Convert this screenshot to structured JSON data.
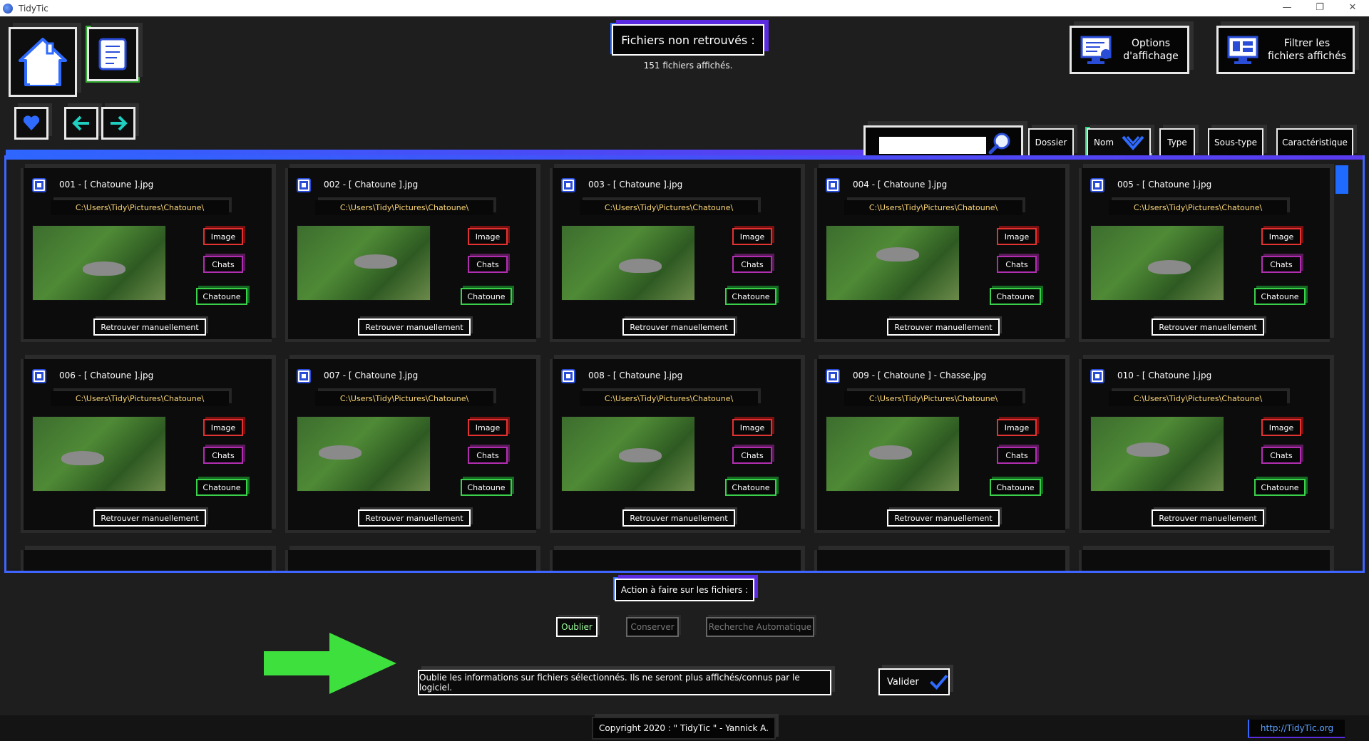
{
  "window": {
    "title": "TidyTic",
    "controls": [
      "—",
      "❐",
      "✕"
    ]
  },
  "header": {
    "title": "Fichiers non retrouvés :",
    "subtitle": "151 fichiers affichés."
  },
  "top_buttons": {
    "options_label_1": "Options",
    "options_label_2": "d'affichage",
    "filter_label_1": "Filtrer les",
    "filter_label_2": "fichiers affichés"
  },
  "sort": {
    "search_value": "",
    "buttons": [
      "Dossier",
      "Nom",
      "Type",
      "Sous-type",
      "Caractéristique"
    ],
    "active": "Nom"
  },
  "files": [
    {
      "name": "001 - [ Chatoune ].jpg",
      "path": "C:\\Users\\Tidy\\Pictures\\Chatoune\\",
      "tag1": "Image",
      "tag2": "Chats",
      "tag3": "Chatoune",
      "action": "Retrouver manuellement"
    },
    {
      "name": "002 - [ Chatoune ].jpg",
      "path": "C:\\Users\\Tidy\\Pictures\\Chatoune\\",
      "tag1": "Image",
      "tag2": "Chats",
      "tag3": "Chatoune",
      "action": "Retrouver manuellement"
    },
    {
      "name": "003 - [ Chatoune ].jpg",
      "path": "C:\\Users\\Tidy\\Pictures\\Chatoune\\",
      "tag1": "Image",
      "tag2": "Chats",
      "tag3": "Chatoune",
      "action": "Retrouver manuellement"
    },
    {
      "name": "004 - [ Chatoune ].jpg",
      "path": "C:\\Users\\Tidy\\Pictures\\Chatoune\\",
      "tag1": "Image",
      "tag2": "Chats",
      "tag3": "Chatoune",
      "action": "Retrouver manuellement"
    },
    {
      "name": "005 - [ Chatoune ].jpg",
      "path": "C:\\Users\\Tidy\\Pictures\\Chatoune\\",
      "tag1": "Image",
      "tag2": "Chats",
      "tag3": "Chatoune",
      "action": "Retrouver manuellement"
    },
    {
      "name": "006 - [ Chatoune ].jpg",
      "path": "C:\\Users\\Tidy\\Pictures\\Chatoune\\",
      "tag1": "Image",
      "tag2": "Chats",
      "tag3": "Chatoune",
      "action": "Retrouver manuellement"
    },
    {
      "name": "007 - [ Chatoune ].jpg",
      "path": "C:\\Users\\Tidy\\Pictures\\Chatoune\\",
      "tag1": "Image",
      "tag2": "Chats",
      "tag3": "Chatoune",
      "action": "Retrouver manuellement"
    },
    {
      "name": "008 - [ Chatoune ].jpg",
      "path": "C:\\Users\\Tidy\\Pictures\\Chatoune\\",
      "tag1": "Image",
      "tag2": "Chats",
      "tag3": "Chatoune",
      "action": "Retrouver manuellement"
    },
    {
      "name": "009 - [ Chatoune ] - Chasse.jpg",
      "path": "C:\\Users\\Tidy\\Pictures\\Chatoune\\",
      "tag1": "Image",
      "tag2": "Chats",
      "tag3": "Chatoune",
      "action": "Retrouver manuellement"
    },
    {
      "name": "010 - [ Chatoune ].jpg",
      "path": "C:\\Users\\Tidy\\Pictures\\Chatoune\\",
      "tag1": "Image",
      "tag2": "Chats",
      "tag3": "Chatoune",
      "action": "Retrouver manuellement"
    }
  ],
  "actions": {
    "title": "Action à faire sur les fichiers :",
    "oublier": "Oublier",
    "conserver": "Conserver",
    "recherche": "Recherche Automatique",
    "info": "Oublie les informations sur fichiers sélectionnés. Ils ne seront plus affichés/connus par le logiciel.",
    "valider": "Valider"
  },
  "footer": {
    "copyright": "Copyright 2020 : \" TidyTic \" - Yannick A.",
    "site": "http://TidyTic.org"
  },
  "colors": {
    "accent_blue": "#2e66ff",
    "accent_purple": "#5a2be0",
    "tag_image": "#e23232",
    "tag_chats": "#b12eb1",
    "tag_chatoune": "#3ad04a",
    "arrow": "#3ee03e"
  }
}
